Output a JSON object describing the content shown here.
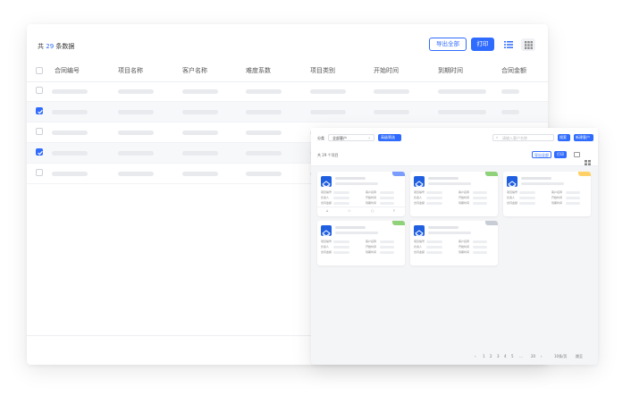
{
  "list": {
    "count_prefix": "共",
    "count_value": "29",
    "count_suffix": "条数据",
    "export_label": "导出全部",
    "print_label": "打印",
    "columns": [
      "合同编号",
      "项目名称",
      "客户名称",
      "难度系数",
      "项目类别",
      "开始时间",
      "到期时间",
      "合同金额"
    ],
    "rows_checked": [
      false,
      true,
      false,
      true,
      false
    ]
  },
  "cards_panel": {
    "filter_label": "分类",
    "filter_value": "全部客户",
    "filter_button": "高级筛选",
    "search_placeholder": "请输入客户名称",
    "search_button": "搜索",
    "new_button": "新建客户",
    "count_text": "共 29 个项目",
    "export_label": "导出全部",
    "print_label": "打印",
    "field_labels": [
      "项目编号",
      "客户名称",
      "负责人",
      "开始时间",
      "合同金额",
      "到期时间"
    ],
    "tag_colors": [
      "#7a9cff",
      "#8fd27a",
      "#ffd166",
      "#8fd27a",
      "#c8ccd4"
    ],
    "pager": [
      "‹",
      "1",
      "2",
      "3",
      "4",
      "5",
      "…",
      "20",
      "›",
      "10条/页",
      "跳至"
    ]
  },
  "colors": {
    "accent": "#2f6bff",
    "logo": "#1f5fe0"
  }
}
